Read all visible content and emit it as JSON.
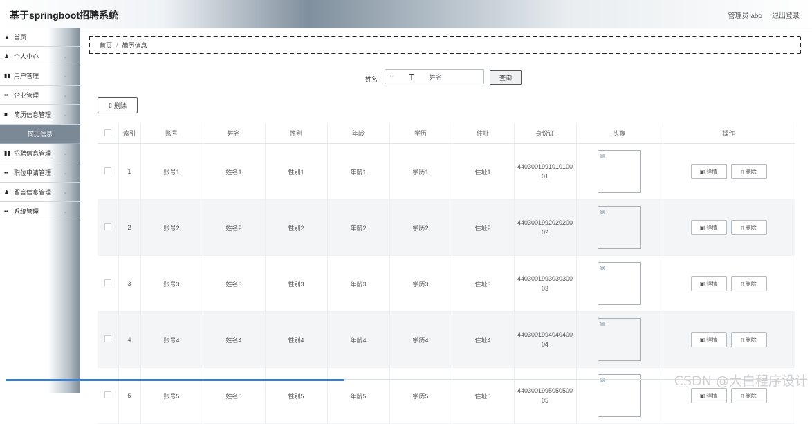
{
  "header": {
    "title": "基于springboot招聘系统",
    "admin_label": "管理员 abo",
    "logout_label": "退出登录"
  },
  "sidebar": {
    "items": [
      {
        "icon": "home-icon",
        "glyph": "▲",
        "label": "首页",
        "chevron": false
      },
      {
        "icon": "user-icon",
        "glyph": "▲",
        "label": "个人中心",
        "chevron": true
      },
      {
        "icon": "grid-icon",
        "glyph": "▮▮",
        "label": "用户管理",
        "chevron": true
      },
      {
        "icon": "grid-icon",
        "glyph": "▮▮",
        "label": "企业管理",
        "chevron": true
      },
      {
        "icon": "folder-icon",
        "glyph": "■",
        "label": "简历信息管理",
        "chevron": true
      },
      {
        "icon": "",
        "glyph": "",
        "label": "简历信息",
        "chevron": false,
        "sub": true
      },
      {
        "icon": "grid-icon",
        "glyph": "▮▮",
        "label": "招聘信息管理",
        "chevron": true
      },
      {
        "icon": "grid-icon",
        "glyph": "▮▮",
        "label": "职位申请管理",
        "chevron": true
      },
      {
        "icon": "user-icon",
        "glyph": "▲",
        "label": "留言信息管理",
        "chevron": true
      },
      {
        "icon": "grid-icon",
        "glyph": "▮▮",
        "label": "系统管理",
        "chevron": true
      }
    ]
  },
  "breadcrumb": {
    "home": "首页",
    "separator": "/",
    "current": "简历信息"
  },
  "search": {
    "label": "姓名",
    "placeholder": "姓名",
    "button": "查询"
  },
  "toolbar": {
    "delete_label": "删除"
  },
  "table": {
    "columns": [
      "",
      "索引",
      "账号",
      "姓名",
      "性别",
      "年龄",
      "学历",
      "住址",
      "身份证",
      "头像",
      "操作"
    ],
    "rows": [
      {
        "index": "1",
        "account": "账号1",
        "name": "姓名1",
        "gender": "性别1",
        "age": "年龄1",
        "education": "学历1",
        "address": "住址1",
        "id_line1": "4403001991010100",
        "id_line2": "01"
      },
      {
        "index": "2",
        "account": "账号2",
        "name": "姓名2",
        "gender": "性别2",
        "age": "年龄2",
        "education": "学历2",
        "address": "住址2",
        "id_line1": "4403001992020200",
        "id_line2": "02"
      },
      {
        "index": "3",
        "account": "账号3",
        "name": "姓名3",
        "gender": "性别3",
        "age": "年龄3",
        "education": "学历3",
        "address": "住址3",
        "id_line1": "4403001993030300",
        "id_line2": "03"
      },
      {
        "index": "4",
        "account": "账号4",
        "name": "姓名4",
        "gender": "性别4",
        "age": "年龄4",
        "education": "学历4",
        "address": "住址4",
        "id_line1": "4403001994040400",
        "id_line2": "04"
      },
      {
        "index": "5",
        "account": "账号5",
        "name": "姓名5",
        "gender": "性别5",
        "age": "年龄5",
        "education": "学历5",
        "address": "住址5",
        "id_line1": "4403001995050500",
        "id_line2": "05"
      }
    ],
    "detail_label": "详情",
    "delete_label": "删除"
  },
  "watermark": "CSDN @大白程序设计"
}
